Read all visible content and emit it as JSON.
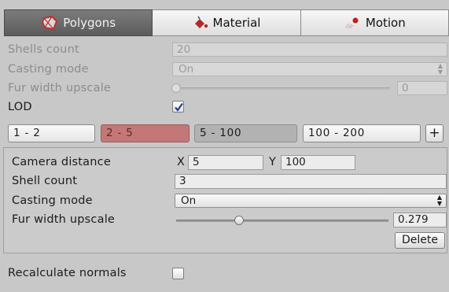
{
  "tabs": [
    {
      "label": "Polygons",
      "icon": "polygons-icon",
      "active": true
    },
    {
      "label": "Material",
      "icon": "material-icon",
      "active": false
    },
    {
      "label": "Motion",
      "icon": "motion-icon",
      "active": false
    }
  ],
  "shells_count": {
    "label": "Shells count",
    "value": "20"
  },
  "casting_mode": {
    "label": "Casting mode",
    "value": "On"
  },
  "fur_width_upscale": {
    "label": "Fur width upscale",
    "value": "0",
    "slider_fraction": 0.0
  },
  "lod": {
    "label": "LOD",
    "checked": true
  },
  "lod_ranges": [
    {
      "label": "1 - 2",
      "state": "normal"
    },
    {
      "label": "2 - 5",
      "state": "selected"
    },
    {
      "label": "5 - 100",
      "state": "dim"
    },
    {
      "label": "100 - 200",
      "state": "normal"
    }
  ],
  "add_range_label": "+",
  "lod_panel": {
    "camera_distance": {
      "label": "Camera distance",
      "x_label": "X",
      "x_value": "5",
      "y_label": "Y",
      "y_value": "100"
    },
    "shell_count": {
      "label": "Shell count",
      "value": "3"
    },
    "casting_mode": {
      "label": "Casting mode",
      "value": "On"
    },
    "fur_width_upscale": {
      "label": "Fur width upscale",
      "value": "0.279",
      "slider_fraction": 0.279
    },
    "delete_label": "Delete"
  },
  "recalculate_normals": {
    "label": "Recalculate normals",
    "checked": false
  },
  "colors": {
    "accent": "#c47777",
    "active_tab": "#6b6b6b",
    "background": "#c8c8c8"
  }
}
